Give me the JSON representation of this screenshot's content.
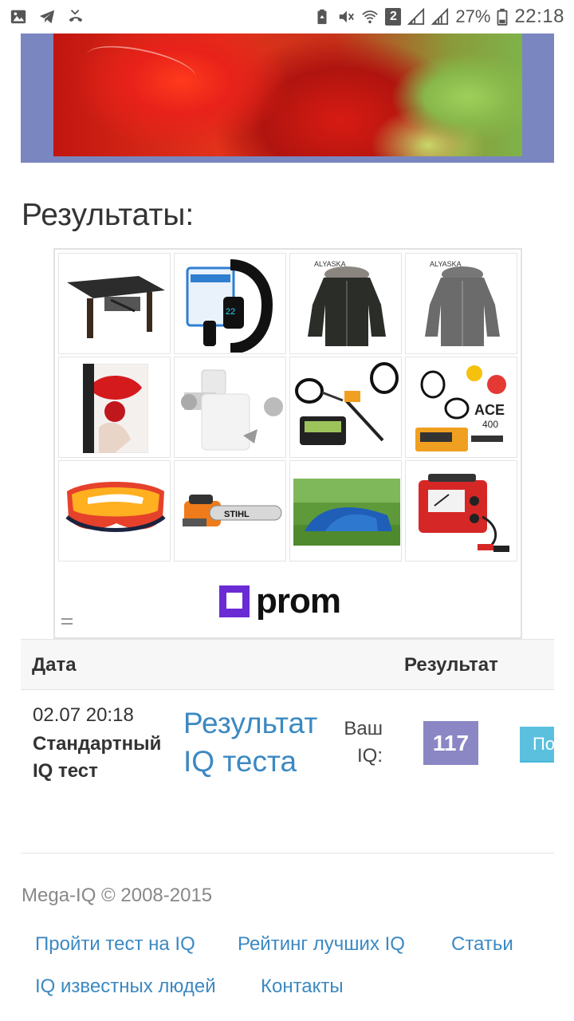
{
  "status_bar": {
    "time": "22:18",
    "battery_percent": "27%",
    "sim_badge": "2",
    "icons": [
      "gallery-icon",
      "telegram-icon",
      "missed-call-icon",
      "battery-saver-icon",
      "mute-icon",
      "wifi-icon",
      "signal-icon",
      "signal-icon",
      "battery-icon"
    ]
  },
  "page": {
    "results_title": "Результаты:"
  },
  "ad": {
    "brand": "prom",
    "products": [
      "transforming-table",
      "fitness-bracelet",
      "winter-jacket-black",
      "winter-jacket-grey",
      "lips-rose-painting",
      "meat-grinder",
      "metal-detector",
      "metal-detector-ace-400",
      "ski-goggles",
      "stihl-chainsaw",
      "camping-tent",
      "battery-charger"
    ]
  },
  "table": {
    "header_date": "Дата",
    "header_result": "Результат",
    "rows": [
      {
        "date": "02.07 20:18",
        "test_name": "Стандартный IQ тест",
        "link": "Результат IQ теста",
        "your_iq_label": "Ваш IQ:",
        "iq_value": "117",
        "button_label": "Подробнее"
      }
    ]
  },
  "footer": {
    "copyright": "Mega-IQ © 2008-2015",
    "links": [
      "Пройти тест на IQ",
      "Рейтинг лучших IQ",
      "Статьи",
      "IQ известных людей",
      "Контакты"
    ]
  },
  "colors": {
    "link": "#3c89c2",
    "iq_badge": "#8a87c4",
    "button": "#5bc0de",
    "hero_frame": "#7a86c0",
    "prom_purple": "#6b2bd4"
  }
}
